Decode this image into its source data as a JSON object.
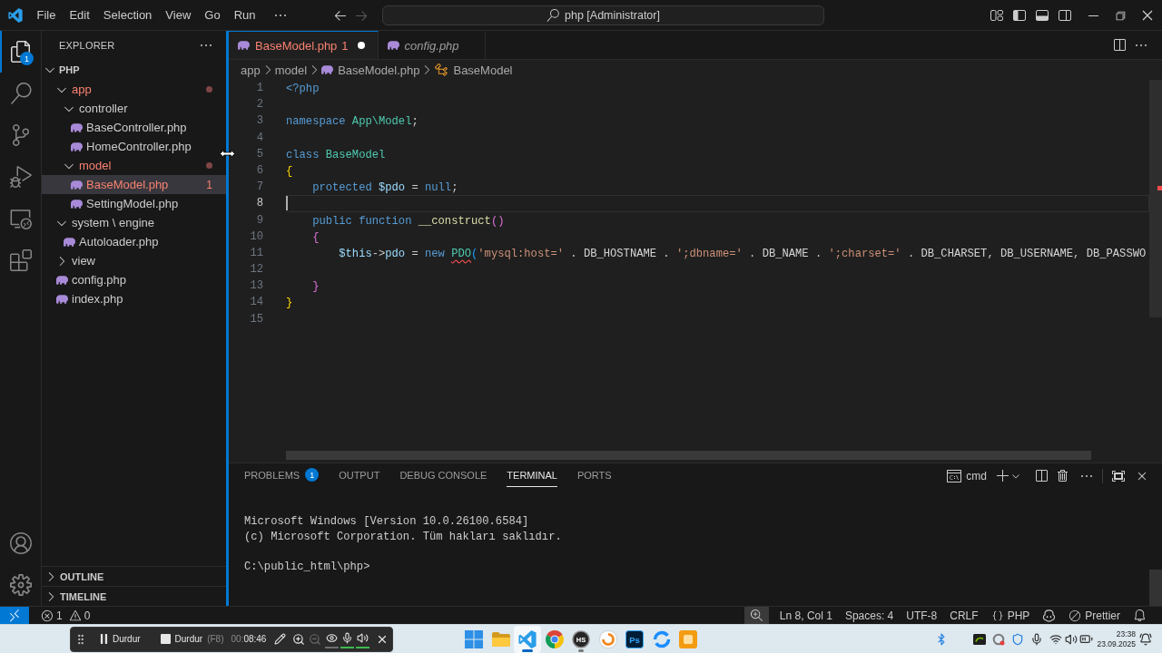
{
  "title_bar": {
    "menus": [
      "File",
      "Edit",
      "Selection",
      "View",
      "Go",
      "Run"
    ],
    "navigation": {
      "back_disabled": false,
      "forward_disabled": true
    },
    "search": "php [Administrator]",
    "layout": {
      "primary_sidebar": true,
      "panel": true,
      "secondary_sidebar": false
    }
  },
  "activity_bar": {
    "items": [
      {
        "selected": true,
        "badge": "1"
      },
      {
        "selected": false
      },
      {
        "selected": false
      },
      {
        "selected": false
      },
      {
        "selected": false
      },
      {
        "selected": false
      }
    ]
  },
  "sidebar": {
    "title": "EXPLORER",
    "resizing": true,
    "root": {
      "label": "PHP",
      "expanded": true
    },
    "tree": [
      {
        "kind": "folder",
        "label": "app",
        "expanded": true,
        "error": true,
        "selected": false,
        "children": [
          {
            "kind": "folder",
            "label": "controller",
            "expanded": true,
            "error": false,
            "selected": false,
            "children": [
              {
                "kind": "file",
                "label": "BaseController.php",
                "error": false,
                "selected": false
              },
              {
                "kind": "file",
                "label": "HomeController.php",
                "error": false,
                "selected": false
              }
            ]
          },
          {
            "kind": "folder",
            "label": "model",
            "expanded": true,
            "error": true,
            "selected": false,
            "children": [
              {
                "kind": "file",
                "label": "BaseModel.php",
                "error": true,
                "problems": "1",
                "selected": true
              },
              {
                "kind": "file",
                "label": "SettingModel.php",
                "error": false,
                "selected": false
              }
            ]
          }
        ]
      },
      {
        "kind": "folder",
        "label": "system \\ engine",
        "expanded": true,
        "error": false,
        "selected": false,
        "children": [
          {
            "kind": "file",
            "label": "Autoloader.php",
            "error": false,
            "selected": false
          }
        ]
      },
      {
        "kind": "folder",
        "label": "view",
        "expanded": false,
        "error": false,
        "selected": false
      },
      {
        "kind": "file",
        "label": "config.php",
        "error": false,
        "selected": false
      },
      {
        "kind": "file",
        "label": "index.php",
        "error": false,
        "selected": false
      }
    ],
    "sections": [
      {
        "label": "OUTLINE",
        "expanded": false
      },
      {
        "label": "TIMELINE",
        "expanded": false
      }
    ]
  },
  "editor": {
    "tabs": [
      {
        "label": "BaseModel.php",
        "problems": "1",
        "selected": true,
        "dirty": true,
        "error": true,
        "preview": false
      },
      {
        "label": "config.php",
        "selected": false,
        "dirty": false,
        "error": false,
        "preview": true
      }
    ],
    "breadcrumbs": [
      {
        "label": "app",
        "kind": "folder"
      },
      {
        "label": "model",
        "kind": "folder"
      },
      {
        "label": "BaseModel.php",
        "kind": "file"
      },
      {
        "label": "BaseModel",
        "kind": "class"
      }
    ],
    "lines": [
      {
        "number": "1",
        "current": false,
        "tokens": [
          {
            "kind": "tag",
            "text": "<?php"
          }
        ]
      },
      {
        "number": "2",
        "current": false
      },
      {
        "number": "3",
        "current": false,
        "tokens": [
          {
            "kind": "keyword",
            "text": "namespace "
          },
          {
            "kind": "type",
            "text": "App\\Model"
          },
          {
            "kind": "plain",
            "text": ";"
          }
        ]
      },
      {
        "number": "4",
        "current": false
      },
      {
        "number": "5",
        "current": false,
        "tokens": [
          {
            "kind": "keyword",
            "text": "class "
          },
          {
            "kind": "type",
            "text": "BaseModel"
          }
        ]
      },
      {
        "number": "6",
        "current": false,
        "tokens": [
          {
            "kind": "bracket1",
            "text": "{"
          }
        ]
      },
      {
        "number": "7",
        "current": false,
        "tokens": [
          {
            "kind": "keyword",
            "text": "    protected "
          },
          {
            "kind": "variable",
            "text": "$pdo"
          },
          {
            "kind": "plain",
            "text": " = "
          },
          {
            "kind": "keyword",
            "text": "null"
          },
          {
            "kind": "plain",
            "text": ";"
          }
        ]
      },
      {
        "number": "8",
        "current": true
      },
      {
        "number": "9",
        "current": false,
        "tokens": [
          {
            "kind": "keyword",
            "text": "    public function "
          },
          {
            "kind": "function",
            "text": "__construct"
          },
          {
            "kind": "bracket2",
            "text": "()"
          }
        ]
      },
      {
        "number": "10",
        "current": false,
        "tokens": [
          {
            "kind": "bracket2",
            "text": "    {"
          }
        ]
      },
      {
        "number": "11",
        "current": false,
        "tokens": [
          {
            "kind": "variable",
            "text": "        $this"
          },
          {
            "kind": "plain",
            "text": "->"
          },
          {
            "kind": "variable",
            "text": "pdo"
          },
          {
            "kind": "plain",
            "text": " = "
          },
          {
            "kind": "keyword",
            "text": "new "
          },
          {
            "kind": "undefined",
            "text": "PDO"
          },
          {
            "kind": "bracket3",
            "text": "("
          },
          {
            "kind": "string",
            "text": "'mysql:host='"
          },
          {
            "kind": "plain",
            "text": " . "
          },
          {
            "kind": "constant",
            "text": "DB_HOSTNAME"
          },
          {
            "kind": "plain",
            "text": " . "
          },
          {
            "kind": "string",
            "text": "';dbname='"
          },
          {
            "kind": "plain",
            "text": " . "
          },
          {
            "kind": "constant",
            "text": "DB_NAME"
          },
          {
            "kind": "plain",
            "text": " . "
          },
          {
            "kind": "string",
            "text": "';charset='"
          },
          {
            "kind": "plain",
            "text": " . "
          },
          {
            "kind": "constant",
            "text": "DB_CHARSET"
          },
          {
            "kind": "plain",
            "text": ", "
          },
          {
            "kind": "constant",
            "text": "DB_USERNAME"
          },
          {
            "kind": "plain",
            "text": ", "
          },
          {
            "kind": "constant",
            "text": "DB_PASSWO"
          }
        ]
      },
      {
        "number": "12",
        "current": false
      },
      {
        "number": "13",
        "current": false,
        "tokens": [
          {
            "kind": "bracket2",
            "text": "    }"
          }
        ]
      },
      {
        "number": "14",
        "current": false,
        "tokens": [
          {
            "kind": "bracket1",
            "text": "}"
          }
        ]
      },
      {
        "number": "15",
        "current": false
      }
    ]
  },
  "panel": {
    "tabs": [
      {
        "label": "PROBLEMS",
        "badge": "1",
        "selected": false
      },
      {
        "label": "OUTPUT",
        "selected": false
      },
      {
        "label": "DEBUG CONSOLE",
        "selected": false
      },
      {
        "label": "TERMINAL",
        "selected": true
      },
      {
        "label": "PORTS",
        "selected": false
      }
    ],
    "terminal": {
      "shell": "cmd",
      "blocks": [
        [
          "Microsoft Windows [Version 10.0.26100.6584]",
          "(c) Microsoft Corporation. Tüm hakları saklıdır."
        ],
        [
          "C:\\public_html\\php>"
        ]
      ]
    }
  },
  "status_bar": {
    "errors": "1",
    "warnings": "0",
    "zoom_highlighted": true,
    "position": "Ln 8, Col 1",
    "indentation": "Spaces: 4",
    "encoding": "UTF-8",
    "line_ending": "CRLF",
    "language": "PHP",
    "formatter": "Prettier"
  },
  "recording_toolbar": {
    "pause_label": "Durdur",
    "stop_label": "Durdur",
    "stop_shortcut": "(F8)",
    "timer_hours": "00:",
    "timer_rest": "08:46",
    "zoom_out_disabled": true,
    "eye_on": false,
    "mic_on": true,
    "speaker_on": true
  },
  "taskbar": {
    "apps": [
      {
        "active": false,
        "running": false
      },
      {
        "active": false,
        "running": false
      },
      {
        "active": true,
        "running": true
      },
      {
        "active": false,
        "running": false
      },
      {
        "label": "HS",
        "active": false,
        "running": true
      },
      {
        "active": false,
        "running": false
      },
      {
        "label": "Ps",
        "active": false,
        "running": false
      },
      {
        "active": false,
        "running": false
      },
      {
        "active": false,
        "running": false
      }
    ],
    "clock": {
      "time": "23:38",
      "date": "23.09.2025"
    }
  }
}
